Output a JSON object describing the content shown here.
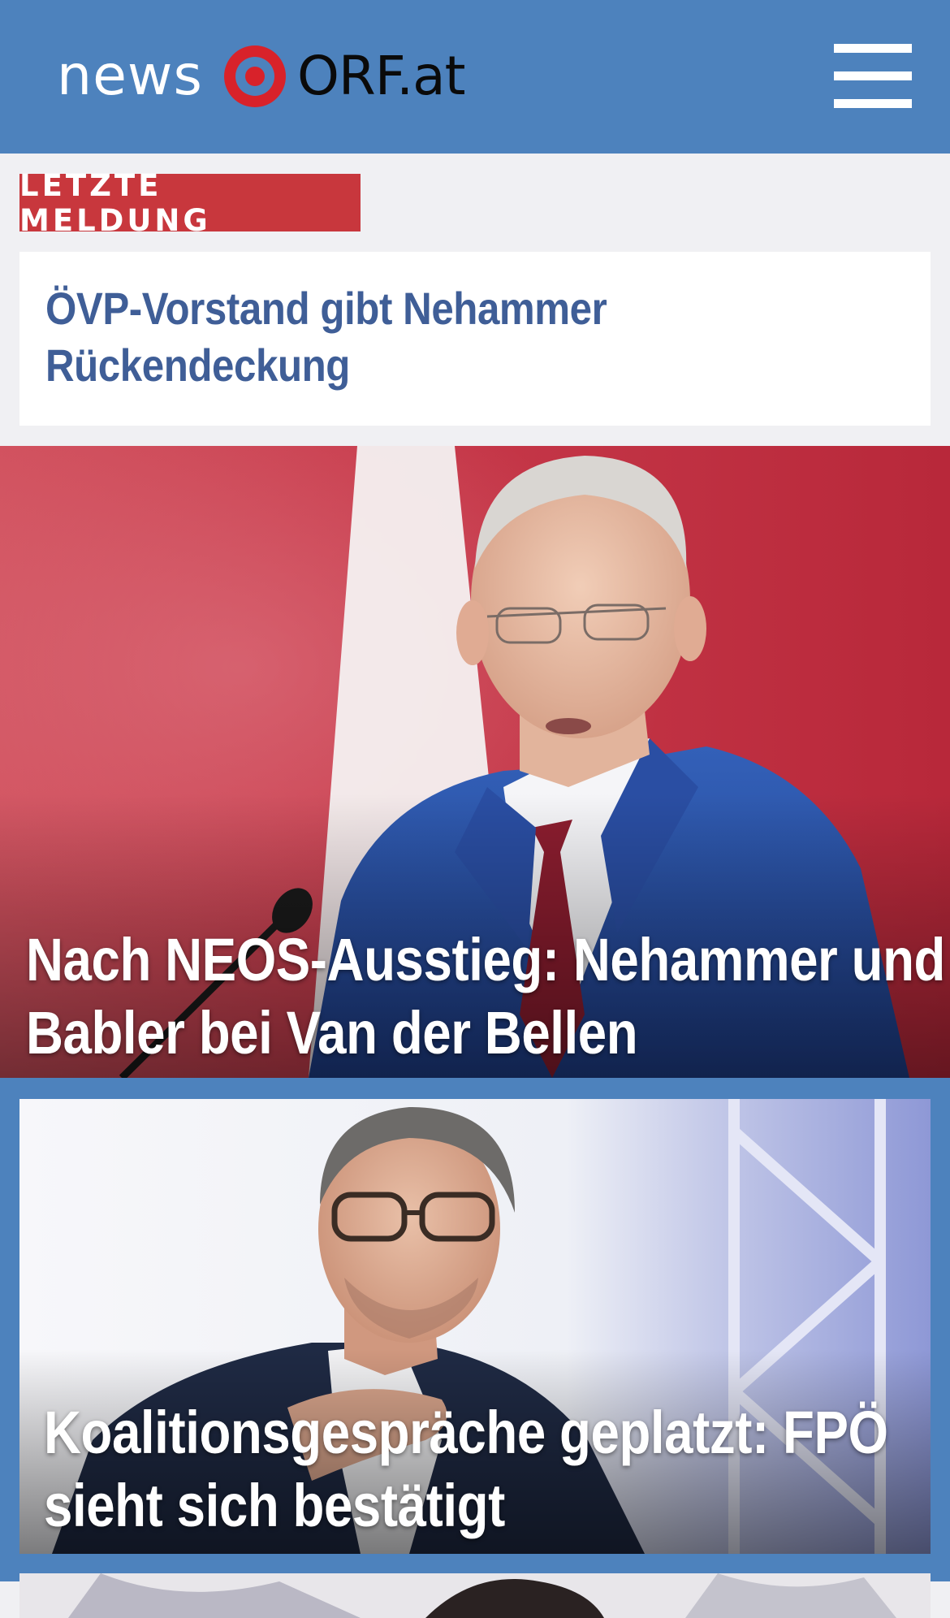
{
  "header": {
    "logo_news": "news",
    "logo_orf": "ORF.at",
    "brand_red": "#d8222a",
    "bar_color": "#4d82bd",
    "menu_icon": "hamburger-menu-icon"
  },
  "breaking": {
    "badge": "LETZTE MELDUNG",
    "badge_color": "#c8373d",
    "headline": "ÖVP-Vorstand gibt Nehammer Rückendeckung"
  },
  "stories": [
    {
      "title": "Nach NEOS-Ausstieg: Nehammer und Babler bei Van der Bellen"
    },
    {
      "title": "Koalitionsgespräche geplatzt: FPÖ sieht sich bestätigt"
    }
  ]
}
